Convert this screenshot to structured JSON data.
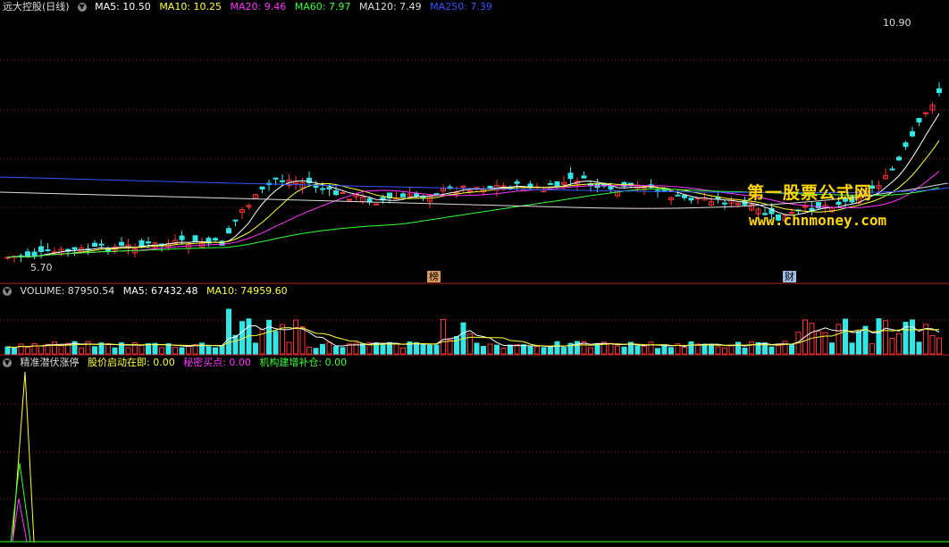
{
  "main": {
    "title": "远大控股(日线)",
    "ma": [
      {
        "label": "MA5: 10.50",
        "color": "#ffffff"
      },
      {
        "label": "MA10: 10.25",
        "color": "#ffff33"
      },
      {
        "label": "MA20: 9.46",
        "color": "#ff33ff"
      },
      {
        "label": "MA60: 7.97",
        "color": "#33ff33"
      },
      {
        "label": "MA120: 7.49",
        "color": "#dddddd"
      },
      {
        "label": "MA250: 7.39",
        "color": "#3355ff"
      }
    ],
    "high_label": "10.90",
    "low_label": "5.70",
    "tag_left": "榜",
    "tag_right": "财"
  },
  "volume": {
    "label": "VOLUME: 87950.54",
    "ma5": "MA5: 67432.48",
    "ma10": "MA10: 74959.60"
  },
  "indicator": {
    "title": "精准潜伏涨停",
    "v1": "股价启动在即: 0.00",
    "v2": "秘密买点: 0.00",
    "v3": "机构建增补仓: 0.00"
  },
  "watermark": {
    "cn": "第一股票公式网",
    "url": "www.chnmoney.com"
  },
  "colors": {
    "up": "#ff3333",
    "down": "#33e6e6",
    "grid": "#8b1a1a"
  }
}
